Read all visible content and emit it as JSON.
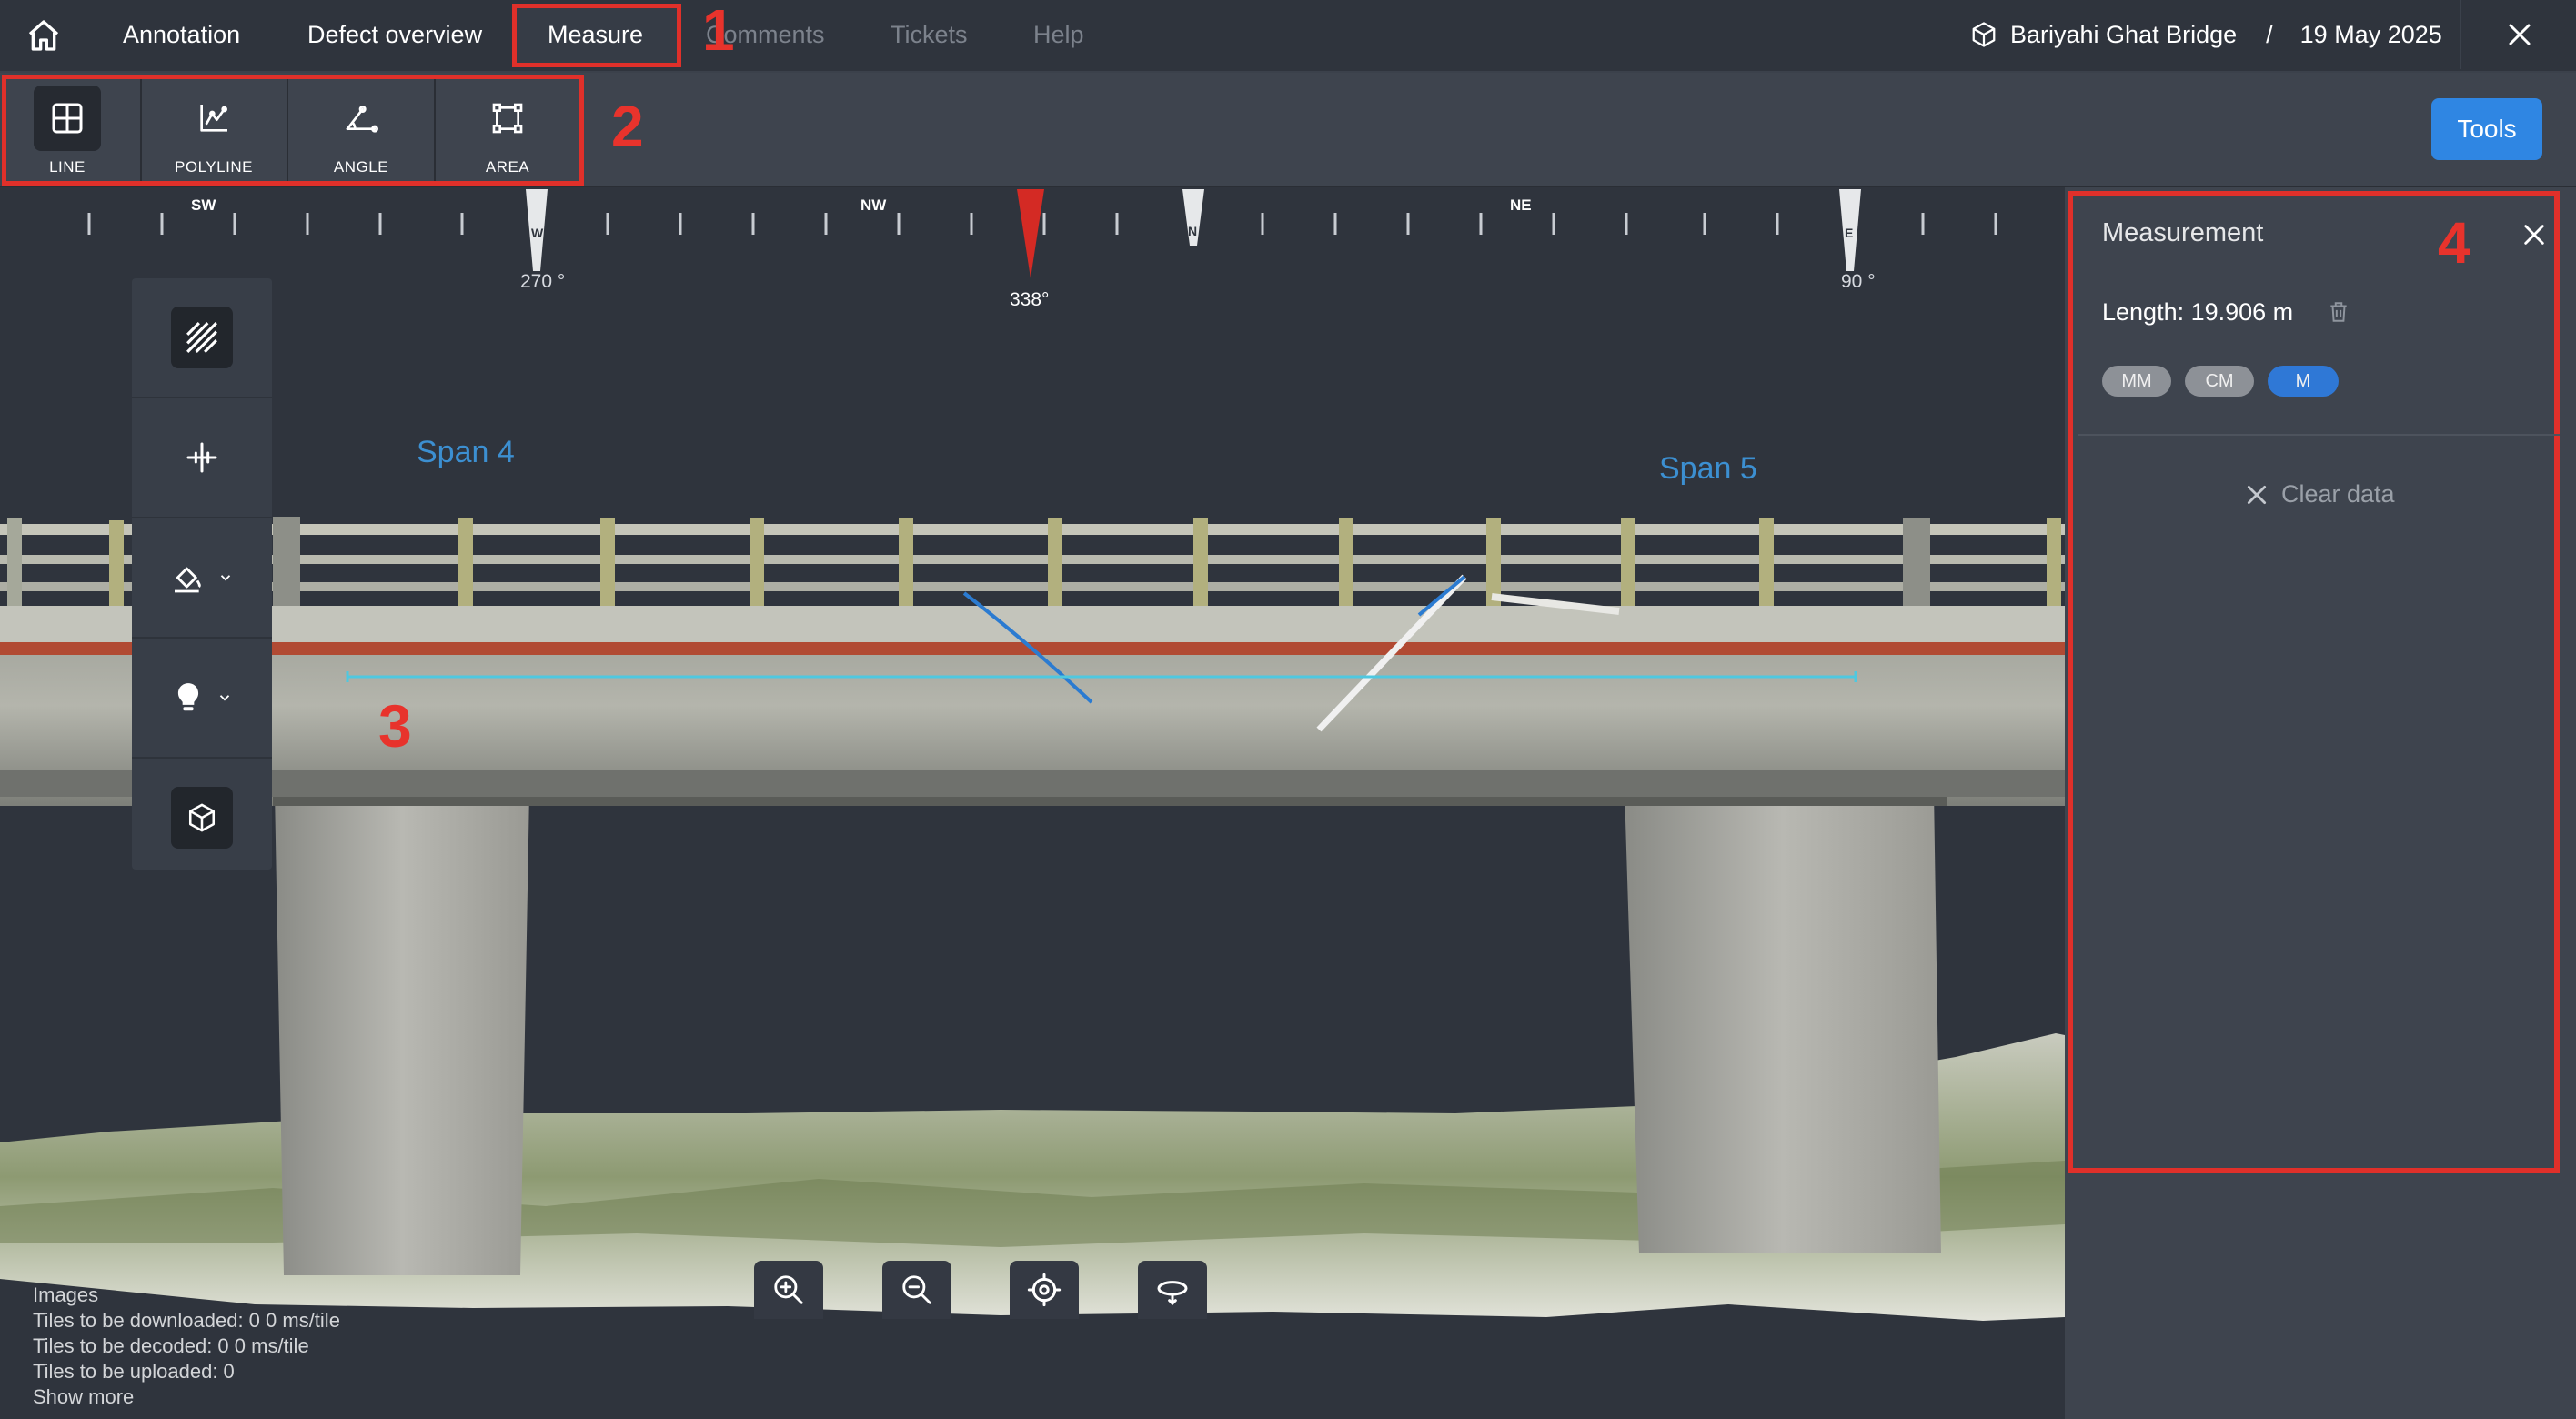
{
  "nav": {
    "items": [
      "Annotation",
      "Defect overview",
      "Measure",
      "Comments",
      "Tickets",
      "Help"
    ],
    "active": "Measure"
  },
  "project": {
    "name": "Bariyahi Ghat Bridge",
    "separator": "/",
    "date": "19 May 2025"
  },
  "toolbar": {
    "tools": [
      {
        "label": "LINE",
        "icon": "grid-icon"
      },
      {
        "label": "POLYLINE",
        "icon": "polyline-icon"
      },
      {
        "label": "ANGLE",
        "icon": "angle-icon"
      },
      {
        "label": "AREA",
        "icon": "area-icon"
      }
    ],
    "selected": "LINE",
    "tools_button": "Tools"
  },
  "compass": {
    "ticks": [
      "SW",
      "W",
      "NW",
      "N",
      "NE",
      "E"
    ],
    "degrees": {
      "west": "270 °",
      "heading": "338°",
      "east": "90 °"
    }
  },
  "scene": {
    "span_left": "Span 4",
    "span_right": "Span 5"
  },
  "annotations": [
    "1",
    "2",
    "3",
    "4"
  ],
  "stats": {
    "line1": "Images",
    "line2": "Tiles to be downloaded: 0    0 ms/tile",
    "line3": "Tiles to be decoded: 0     0 ms/tile",
    "line4": "Tiles to be uploaded: 0",
    "show_more": "Show more"
  },
  "measurement": {
    "title": "Measurement",
    "length_label": "Length: 19.906 m",
    "units": [
      "MM",
      "CM",
      "M"
    ],
    "selected_unit": "M",
    "clear_label": "Clear data"
  },
  "colors": {
    "accent": "#2f86e3",
    "annotation_red": "#e0302a",
    "measure_line": "#4ec8e0"
  }
}
